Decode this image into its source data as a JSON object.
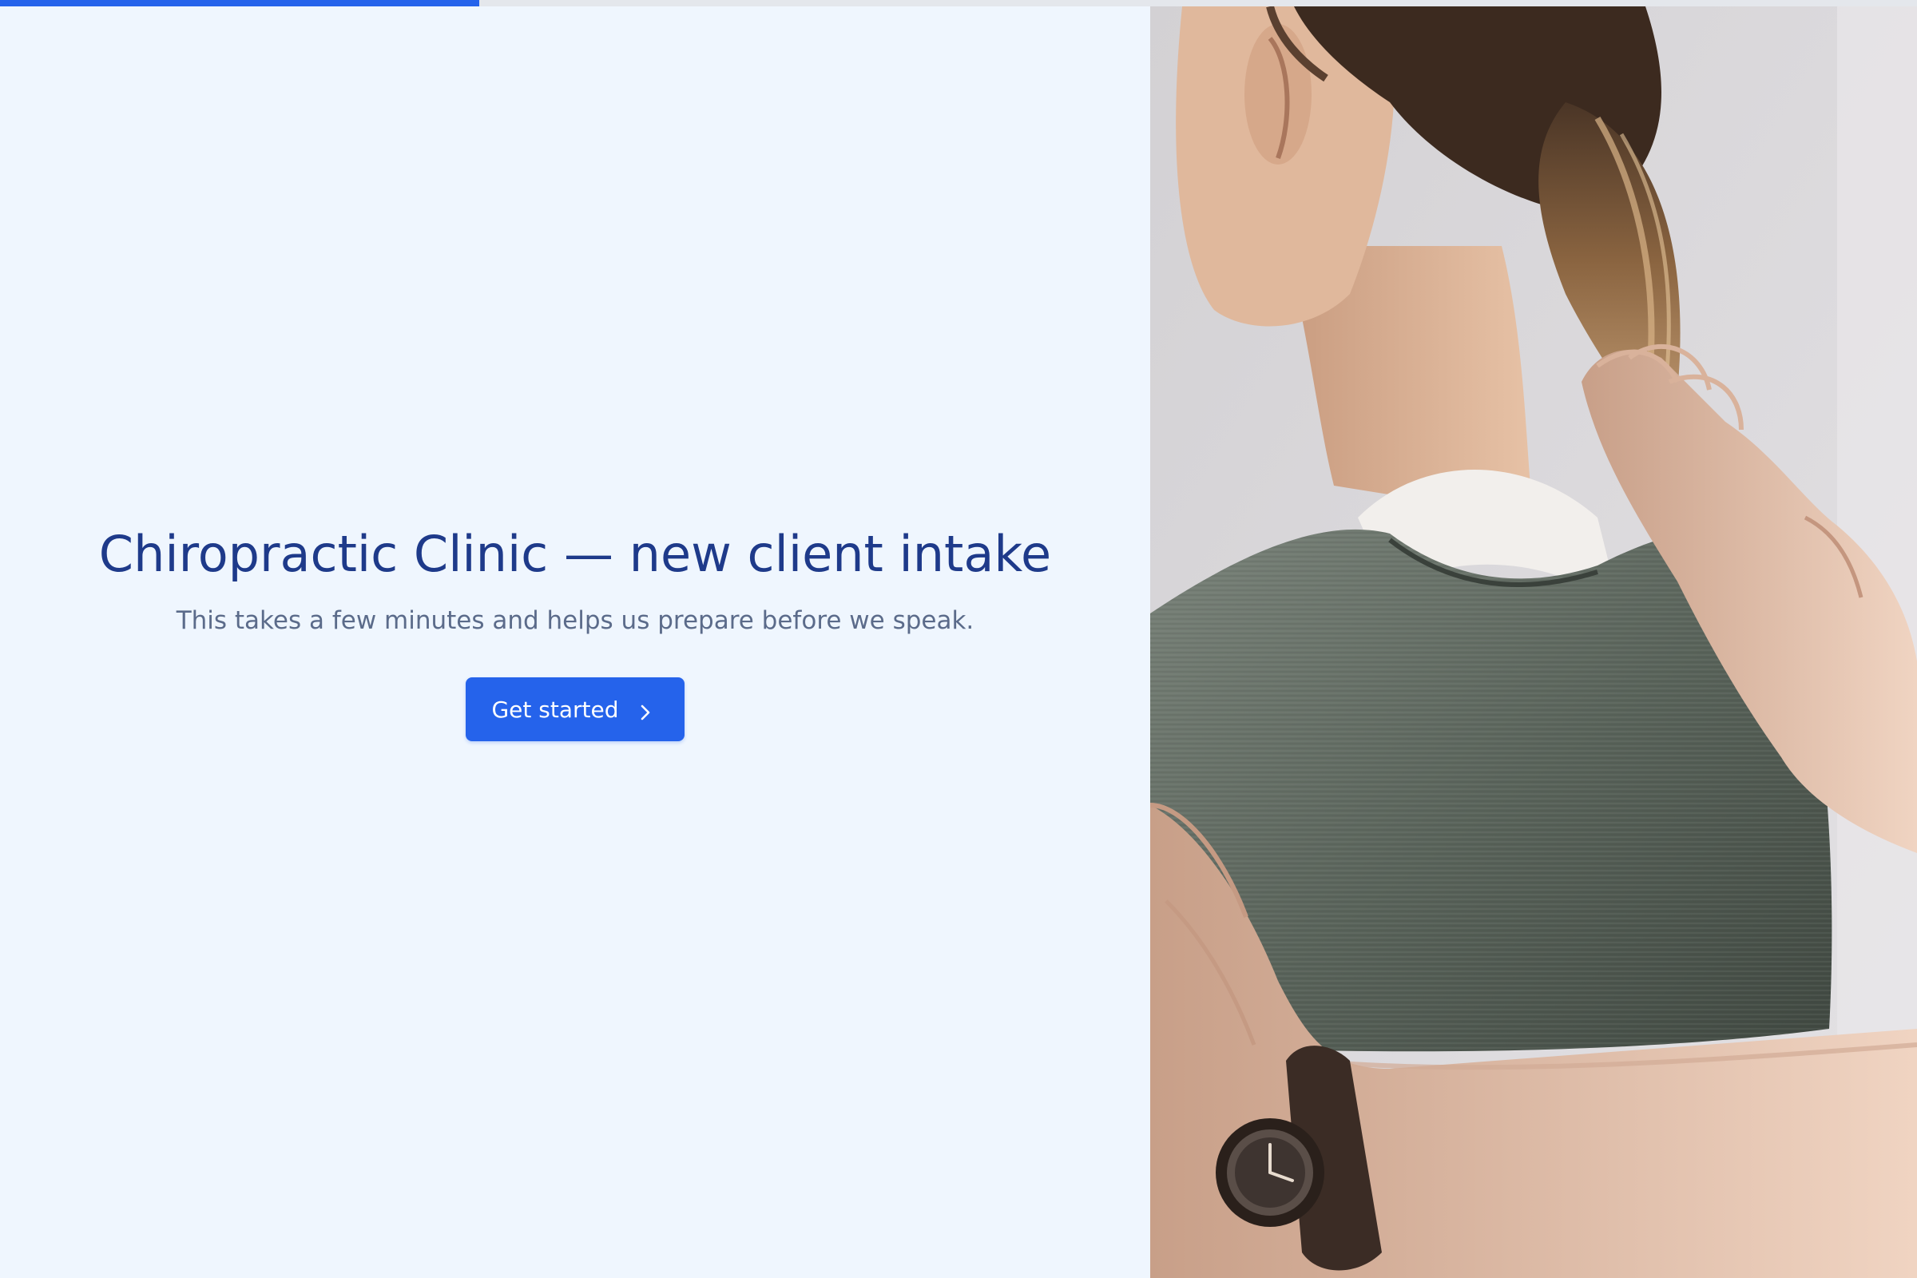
{
  "progress": {
    "value_percent": 25,
    "color": "#2563eb"
  },
  "intro": {
    "title": "Chiropractic Clinic — new client intake",
    "subtitle": "This takes a few minutes and helps us prepare before we speak.",
    "cta_label": "Get started",
    "cta_icon": "chevron-right-icon"
  },
  "hero_image": {
    "subject": "back-adjustment-photo"
  },
  "colors": {
    "accent": "#2563eb",
    "title": "#1e3a8a",
    "subtitle": "#5b6b8a",
    "background": "#eff6fe"
  }
}
